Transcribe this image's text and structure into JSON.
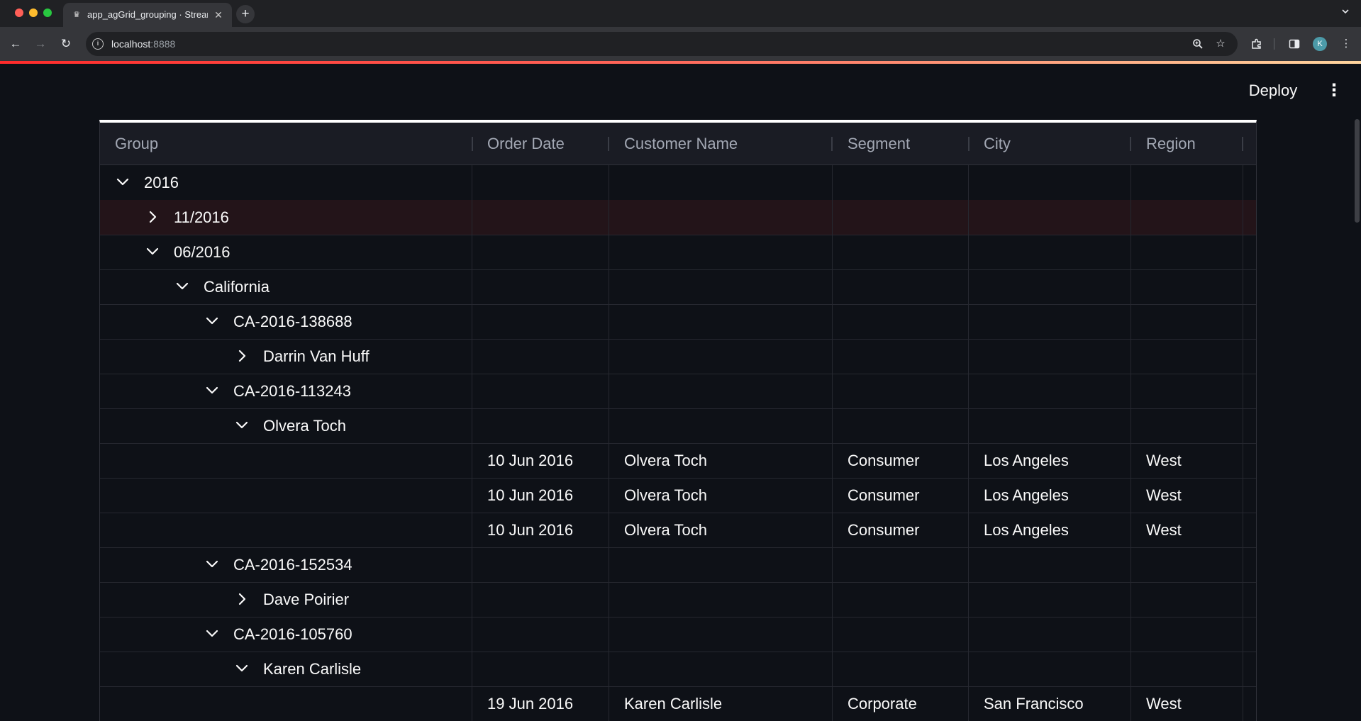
{
  "browser": {
    "tab_title": "app_agGrid_grouping · Streamlit",
    "tab_favicon": "♛",
    "tab_close": "✕",
    "new_tab": "+",
    "url_host": "localhost",
    "url_port": ":8888",
    "profile_initial": "K"
  },
  "app": {
    "deploy_label": "Deploy",
    "menu_glyph": "⋮"
  },
  "grid": {
    "headers": [
      "Group",
      "Order Date",
      "Customer Name",
      "Segment",
      "City",
      "Region"
    ],
    "rows": [
      {
        "type": "group",
        "level": 0,
        "expanded": true,
        "label": "2016"
      },
      {
        "type": "group",
        "level": 1,
        "expanded": false,
        "label": "11/2016",
        "selected": true
      },
      {
        "type": "group",
        "level": 1,
        "expanded": true,
        "label": "06/2016"
      },
      {
        "type": "group",
        "level": 2,
        "expanded": true,
        "label": "California"
      },
      {
        "type": "group",
        "level": 3,
        "expanded": true,
        "label": "CA-2016-138688"
      },
      {
        "type": "group",
        "level": 4,
        "expanded": false,
        "label": "Darrin Van Huff"
      },
      {
        "type": "group",
        "level": 3,
        "expanded": true,
        "label": "CA-2016-113243"
      },
      {
        "type": "group",
        "level": 4,
        "expanded": true,
        "label": "Olvera Toch"
      },
      {
        "type": "data",
        "cells": [
          "10 Jun 2016",
          "Olvera Toch",
          "Consumer",
          "Los Angeles",
          "West"
        ]
      },
      {
        "type": "data",
        "cells": [
          "10 Jun 2016",
          "Olvera Toch",
          "Consumer",
          "Los Angeles",
          "West"
        ]
      },
      {
        "type": "data",
        "cells": [
          "10 Jun 2016",
          "Olvera Toch",
          "Consumer",
          "Los Angeles",
          "West"
        ]
      },
      {
        "type": "group",
        "level": 3,
        "expanded": true,
        "label": "CA-2016-152534"
      },
      {
        "type": "group",
        "level": 4,
        "expanded": false,
        "label": "Dave Poirier"
      },
      {
        "type": "group",
        "level": 3,
        "expanded": true,
        "label": "CA-2016-105760"
      },
      {
        "type": "group",
        "level": 4,
        "expanded": true,
        "label": "Karen Carlisle"
      },
      {
        "type": "data",
        "cells": [
          "19 Jun 2016",
          "Karen Carlisle",
          "Corporate",
          "San Francisco",
          "West"
        ]
      }
    ]
  }
}
